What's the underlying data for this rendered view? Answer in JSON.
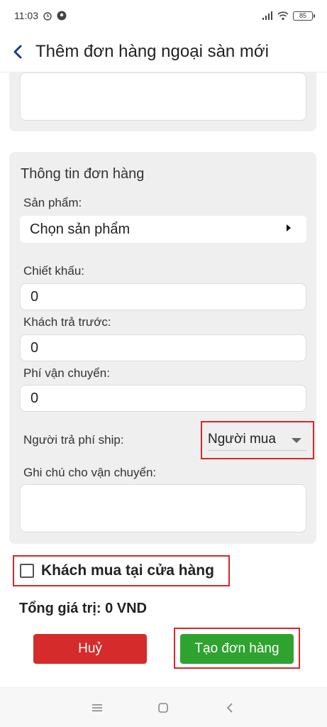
{
  "status_bar": {
    "time": "11:03",
    "battery": "85"
  },
  "header": {
    "title": "Thêm đơn hàng ngoại sàn mới"
  },
  "order_info": {
    "section_title": "Thông tin đơn hàng",
    "product_label": "Sản phẩm:",
    "product_placeholder": "Chọn sản phẩm",
    "discount_label": "Chiết khấu:",
    "discount_value": "0",
    "prepaid_label": "Khách trả trước:",
    "prepaid_value": "0",
    "shipping_fee_label": "Phí vận chuyển:",
    "shipping_fee_value": "0",
    "ship_payer_label": "Người trả phí ship:",
    "ship_payer_value": "Người mua",
    "shipping_note_label": "Ghi chú cho vận chuyển:"
  },
  "in_store": {
    "label": "Khách mua tại cửa hàng",
    "checked": false
  },
  "total": {
    "text": "Tổng giá trị: 0 VND"
  },
  "actions": {
    "cancel_label": "Huỷ",
    "create_label": "Tạo đơn hàng"
  },
  "colors": {
    "cancel": "#d52b2b",
    "create": "#2fa32f",
    "highlight": "#d9262a",
    "card": "#efefef"
  }
}
